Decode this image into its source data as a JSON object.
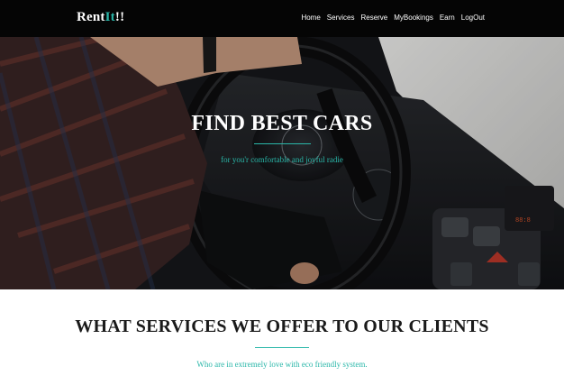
{
  "nav": {
    "brand_prefix": "Rent",
    "brand_accent": "It",
    "brand_suffix": "!!",
    "links": [
      "Home",
      "Services",
      "Reserve",
      "MyBookings",
      "Earn",
      "LogOut"
    ]
  },
  "hero": {
    "title": "FIND BEST CARS",
    "subtitle": "for you'r comfortable and joyful radie"
  },
  "services": {
    "title": "WHAT SERVICES WE OFFER TO OUR CLIENTS",
    "subtitle": "Who are in extremely love with eco friendly system."
  },
  "colors": {
    "navbar_bg": "#050505",
    "accent": "#2ab7a9",
    "text_dark": "#1a1a1a"
  }
}
